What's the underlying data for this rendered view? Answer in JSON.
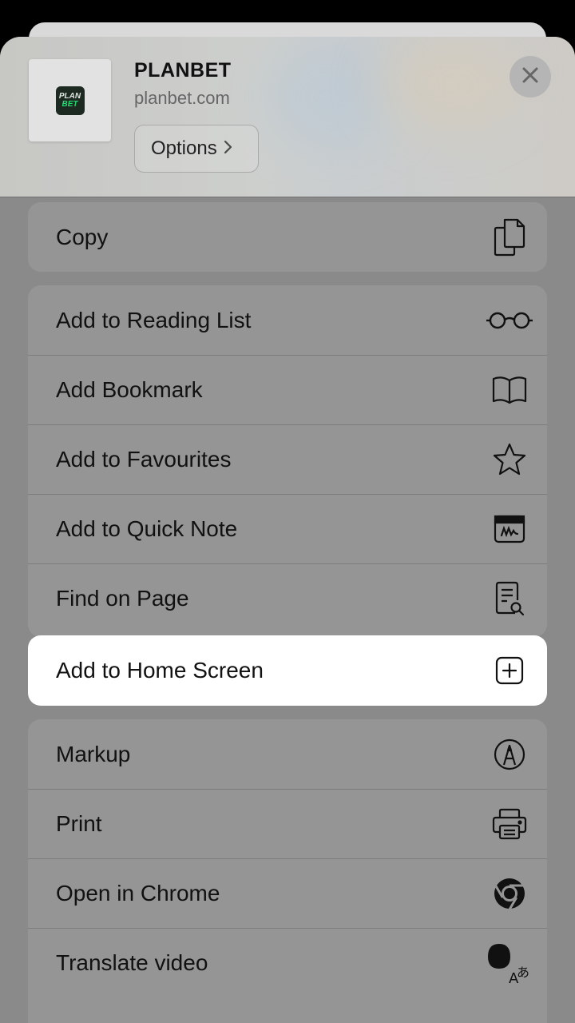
{
  "header": {
    "site_title": "PLANBET",
    "site_url": "planbet.com",
    "options_label": "Options",
    "logo_top": "PLAN",
    "logo_bottom": "BET"
  },
  "groups": [
    [
      {
        "label": "Copy",
        "icon": "copy-icon"
      }
    ],
    [
      {
        "label": "Add to Reading List",
        "icon": "glasses-icon"
      },
      {
        "label": "Add Bookmark",
        "icon": "book-icon"
      },
      {
        "label": "Add to Favourites",
        "icon": "star-icon"
      },
      {
        "label": "Add to Quick Note",
        "icon": "quick-note-icon"
      },
      {
        "label": "Find on Page",
        "icon": "find-on-page-icon"
      },
      {
        "label": "Add to Home Screen",
        "icon": "add-square-icon",
        "highlighted": true
      }
    ],
    [
      {
        "label": "Markup",
        "icon": "markup-pen-icon"
      },
      {
        "label": "Print",
        "icon": "printer-icon"
      },
      {
        "label": "Open in Chrome",
        "icon": "chrome-icon"
      },
      {
        "label": "Translate video",
        "icon": "translate-video-icon"
      }
    ]
  ],
  "colors": {
    "highlight_bg": "#ffffff",
    "dimmed_bg": "#8a8a8a",
    "logo_green": "#23d86f"
  }
}
